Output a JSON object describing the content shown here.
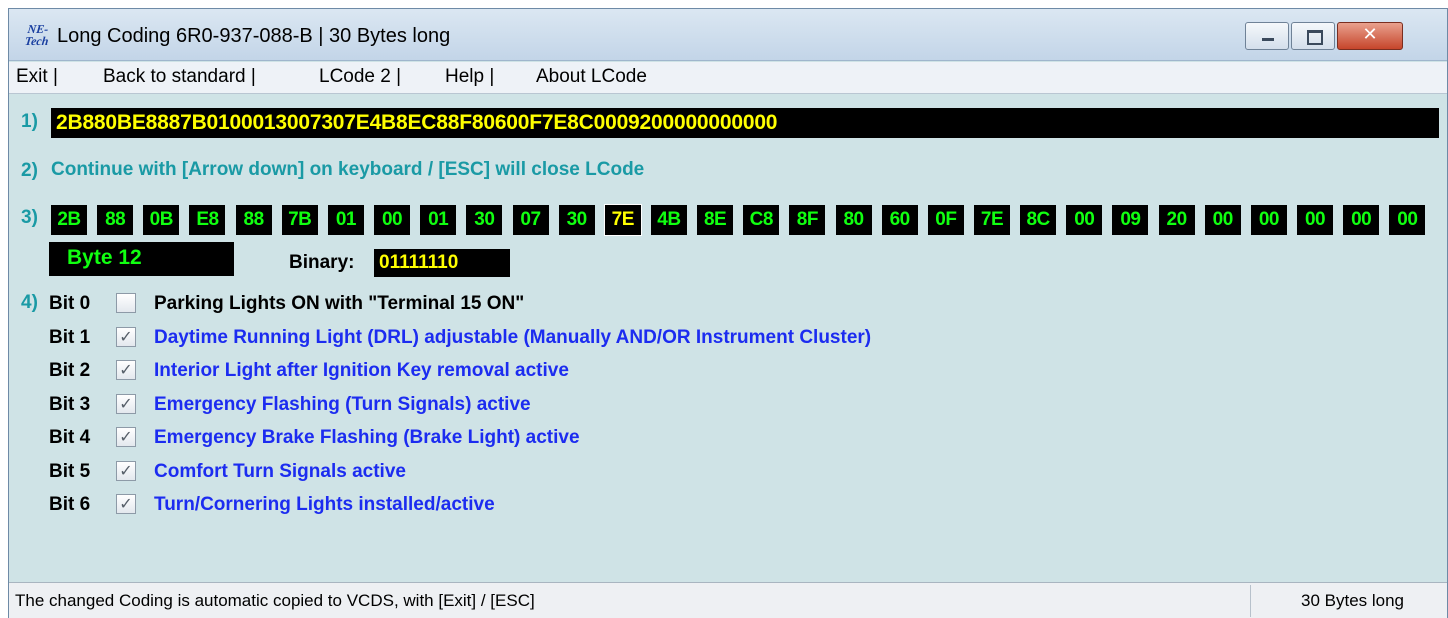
{
  "window": {
    "title": "Long Coding  6R0-937-088-B | 30 Bytes long",
    "logo_line1": "NE-",
    "logo_line2": "Tech"
  },
  "menu": [
    {
      "label": "Exit |"
    },
    {
      "label": "Back to standard |"
    },
    {
      "label": "LCode 2 |"
    },
    {
      "label": "Help |"
    },
    {
      "label": "About LCode"
    }
  ],
  "steps": {
    "step1": "1)",
    "step2": "2)",
    "step3": "3)",
    "step4": "4)"
  },
  "coding": "2B880BE8887B0100013007307E4B8EC88F80600F7E8C0009200000000000",
  "hint": "Continue with [Arrow down] on keyboard / [ESC] will close LCode",
  "bytes": [
    "2B",
    "88",
    "0B",
    "E8",
    "88",
    "7B",
    "01",
    "00",
    "01",
    "30",
    "07",
    "30",
    "7E",
    "4B",
    "8E",
    "C8",
    "8F",
    "80",
    "60",
    "0F",
    "7E",
    "8C",
    "00",
    "09",
    "20",
    "00",
    "00",
    "00",
    "00",
    "00"
  ],
  "selected_byte_index": 12,
  "byte_label": "Byte 12",
  "binary": {
    "label": "Binary:",
    "value": "01111110"
  },
  "bits": [
    {
      "name": "Bit 0",
      "checked": false,
      "description": "Parking Lights ON with \"Terminal 15 ON\""
    },
    {
      "name": "Bit 1",
      "checked": true,
      "description": "Daytime Running Light (DRL) adjustable (Manually AND/OR Instrument Cluster)"
    },
    {
      "name": "Bit 2",
      "checked": true,
      "description": "Interior Light after Ignition Key removal active"
    },
    {
      "name": "Bit 3",
      "checked": true,
      "description": "Emergency Flashing (Turn Signals) active"
    },
    {
      "name": "Bit 4",
      "checked": true,
      "description": "Emergency Brake Flashing (Brake Light) active"
    },
    {
      "name": "Bit 5",
      "checked": true,
      "description": "Comfort Turn Signals active"
    },
    {
      "name": "Bit 6",
      "checked": true,
      "description": "Turn/Cornering Lights installed/active"
    }
  ],
  "status": {
    "left": "The changed Coding is automatic copied to VCDS, with [Exit] / [ESC]",
    "right": "30 Bytes long"
  },
  "colors": {
    "background": "#cfe3e6",
    "step_teal": "#1a9aa5",
    "byte_green": "#10ff10",
    "highlight_yellow": "#ffff00",
    "active_bit_blue": "#1c2cf0"
  }
}
